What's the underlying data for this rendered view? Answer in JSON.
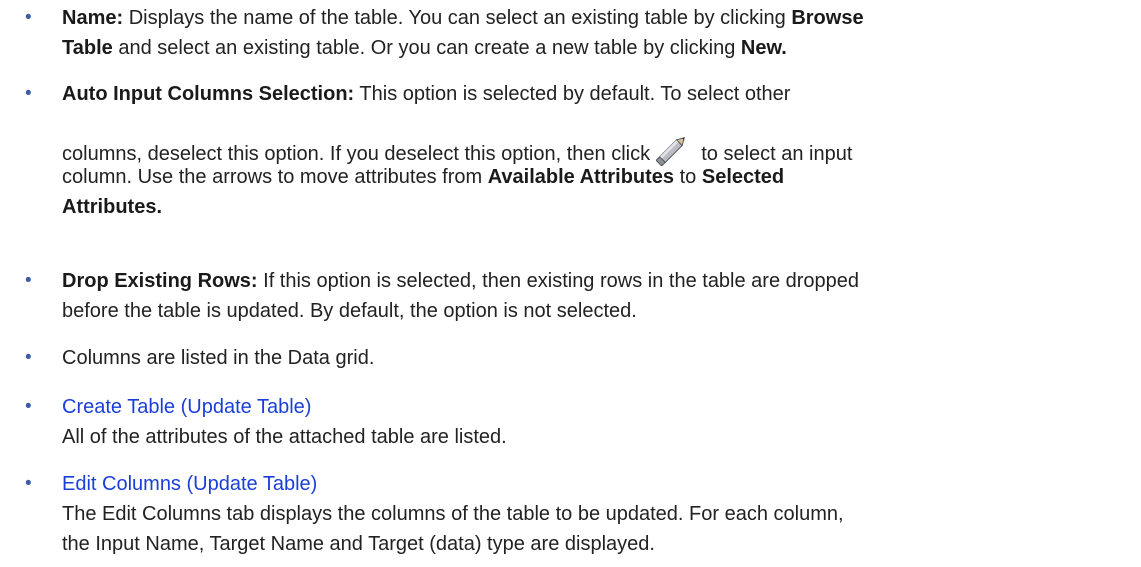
{
  "items": [
    {
      "label": "Name:",
      "text1": " Displays the name of the table. You can select an existing table by clicking ",
      "bold1": "Browse",
      "bold2": "Table",
      "text2": " and select an existing table. Or you can create a new table by clicking ",
      "bold3": "New."
    },
    {
      "label": "Auto Input Columns Selection:",
      "text1": " This option is selected by default. To select other",
      "text2": "columns, deselect this option. If you deselect this option, then click ",
      "text3": " to select an input",
      "text4": "column. Use the arrows to move attributes from ",
      "bold1": "Available Attributes",
      "text5": " to ",
      "bold2": "Selected",
      "bold3": "Attributes.",
      "icon": "pencil-icon"
    },
    {
      "label": "Drop Existing Rows:",
      "text1": " If this option is selected, then existing rows in the table are dropped",
      "text2": "before the table is updated. By default, the option is not selected."
    },
    {
      "text1": "Columns are listed in the Data grid."
    },
    {
      "link": "Create Table (Update Table)",
      "text1": "All of the attributes of the attached table are listed."
    },
    {
      "link": "Edit Columns (Update Table)",
      "text1": "The Edit Columns tab displays the columns of the table to be updated. For each column,",
      "text2": "the Input Name, Target Name and Target (data) type are displayed."
    }
  ],
  "bullet_char": "•",
  "colors": {
    "text": "#222222",
    "link": "#1a3fd8",
    "bullet": "#3a5ea8"
  }
}
